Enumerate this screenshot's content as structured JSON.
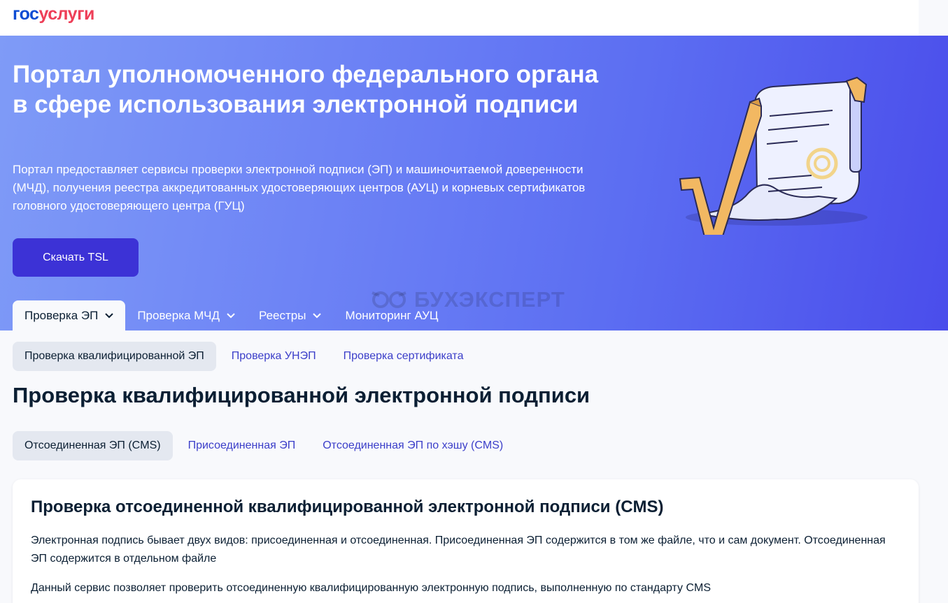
{
  "header": {
    "logo_part1": "гос",
    "logo_part2": "услуги"
  },
  "hero": {
    "title": "Портал уполномоченного федерального органа в сфере использования электронной подписи",
    "description": "Портал предоставляет сервисы проверки электронной подписи (ЭП) и машиночитаемой доверенности (МЧД), получения реестра аккредитованных удостоверяющих центров (АУЦ) и корневых сертификатов головного удостоверяющего центра (ГУЦ)",
    "download_button": "Скачать TSL",
    "watermark": "БУХЭКСПЕРТ"
  },
  "tabs": [
    {
      "label": "Проверка ЭП",
      "active": true,
      "dropdown": true
    },
    {
      "label": "Проверка МЧД",
      "active": false,
      "dropdown": true
    },
    {
      "label": "Реестры",
      "active": false,
      "dropdown": true
    },
    {
      "label": "Мониторинг АУЦ",
      "active": false,
      "dropdown": false
    }
  ],
  "subtabs": [
    {
      "label": "Проверка квалифицированной ЭП",
      "active": true
    },
    {
      "label": "Проверка УНЭП",
      "active": false
    },
    {
      "label": "Проверка сертификата",
      "active": false
    }
  ],
  "section_title": "Проверка квалифицированной электронной подписи",
  "signature_types": [
    {
      "label": "Отсоединенная ЭП (CMS)",
      "active": true
    },
    {
      "label": "Присоединенная ЭП",
      "active": false
    },
    {
      "label": "Отсоединенная ЭП по хэшу (CMS)",
      "active": false
    }
  ],
  "card": {
    "title": "Проверка отсоединенной квалифицированной электронной подписи (CMS)",
    "paragraph1": "Электронная подпись бывает двух видов: присоединенная и отсоединенная. Присоединенная ЭП содержится в том же файле, что и сам документ. Отсоединенная ЭП содержится в отдельном файле",
    "paragraph2": "Данный сервис позволяет проверить отсоединенную квалифицированную электронную подпись, выполненную по стандарту CMS"
  },
  "colors": {
    "brand_blue": "#0d4cd3",
    "brand_red": "#ee3f58",
    "button": "#3c32d6",
    "link": "#3b3ec9"
  }
}
